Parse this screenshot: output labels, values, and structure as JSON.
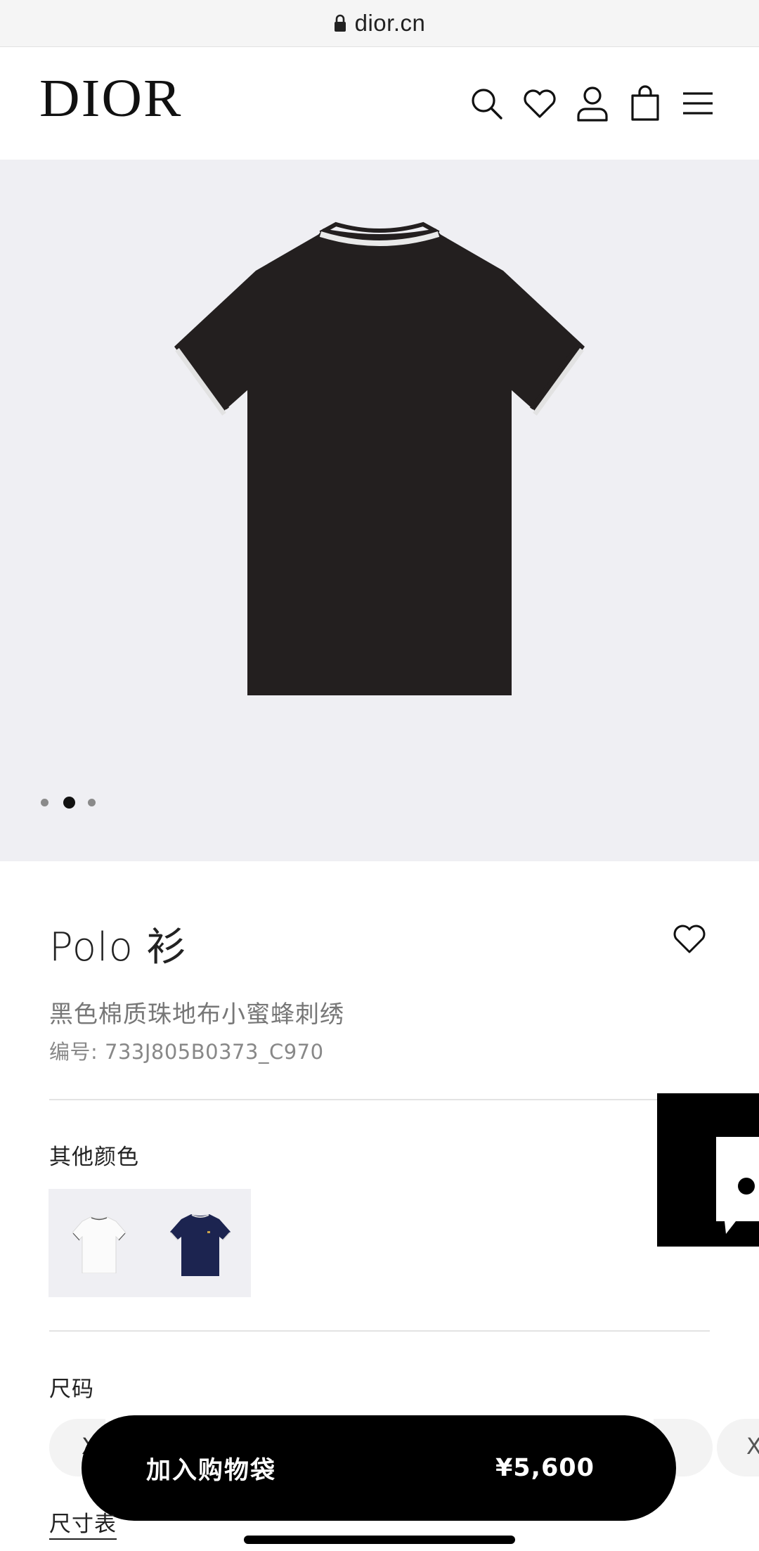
{
  "browser": {
    "url": "dior.cn"
  },
  "header": {
    "logo": "DIOR",
    "icons": [
      "search-icon",
      "heart-icon",
      "user-icon",
      "shopping-bag-icon",
      "menu-icon"
    ]
  },
  "gallery": {
    "image_count": 3,
    "active_index": 1,
    "background": "#efeff3",
    "product_color": "#231f1f"
  },
  "product": {
    "title": "Polo 衫",
    "description": "黑色棉质珠地布小蜜蜂刺绣",
    "code": "编号: 733J805B0373_C970"
  },
  "colors": {
    "label": "其他颜色",
    "options": [
      "white",
      "navy"
    ]
  },
  "sizes": {
    "label": "尺码",
    "first_visible": "X",
    "last_visible": "X"
  },
  "cart": {
    "label": "加入购物袋",
    "price": "¥5,600"
  },
  "size_chart": {
    "label": "尺寸表"
  }
}
